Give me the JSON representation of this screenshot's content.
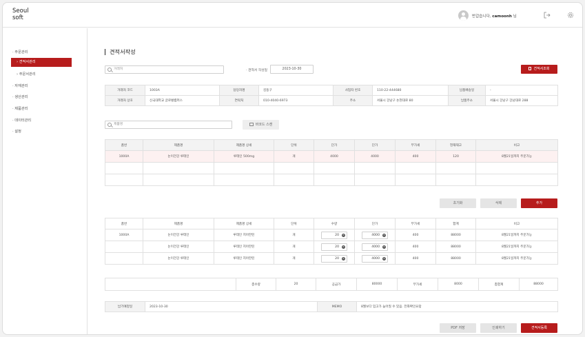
{
  "app": {
    "logo_line1": "Seoul",
    "logo_line2": "soft"
  },
  "header": {
    "greeting": "반갑습니다,",
    "username": "camoonh",
    "suffix": "님",
    "icons": [
      "user-avatar",
      "logout-icon",
      "gear-icon"
    ]
  },
  "sidebar": {
    "items": [
      {
        "label": "· 주문관리"
      },
      {
        "label": "› 견적서관리",
        "active": true
      },
      {
        "label": "› 주문서관리"
      },
      {
        "label": "· 자재관리"
      },
      {
        "label": "· 생산관리"
      },
      {
        "label": "· 제품관리"
      },
      {
        "label": "· 데이터관리"
      },
      {
        "label": "· 설정"
      }
    ]
  },
  "page": {
    "title": "견적서작성"
  },
  "top_filter": {
    "client_placeholder": "거래처",
    "date_label": "· 견적서 작성일",
    "date_value": "2023-10-30",
    "lookup_button": "견적서조회"
  },
  "client_info": {
    "rows": [
      [
        "거래처 코드",
        "1003A",
        "담당자명",
        "김동구",
        "사업자 번호",
        "110-22-444680",
        "납품배송일",
        "-"
      ],
      [
        "거래처 상호",
        "신극대학교 글로벌캠퍼스",
        "연락처",
        "010-4040-6973",
        "주소",
        "서울시 강남구 논현대로 80",
        "납품주소",
        "서울시 강남구 강남대로 288"
      ]
    ]
  },
  "product_search": {
    "placeholder": "제품명",
    "barcode_button": "바코드 스캔"
  },
  "product_table": {
    "headers": [
      "품번",
      "제품명",
      "제품명 상세",
      "단위",
      "단가",
      "단가",
      "부가세",
      "현재재고",
      "비고"
    ],
    "rows": [
      [
        "1000A",
        "눈이건강 루테인",
        "루테인 500mg",
        "개",
        "4000",
        "4000",
        "400",
        "120",
        "8월21일까지 주문가능"
      ],
      [
        "",
        "",
        "",
        "",
        "",
        "",
        "",
        "",
        ""
      ],
      [
        "",
        "",
        "",
        "",
        "",
        "",
        "",
        "",
        ""
      ]
    ]
  },
  "action_buttons": {
    "reset": "초기화",
    "delete": "삭제",
    "add": "추가"
  },
  "order_table": {
    "headers": [
      "품번",
      "제품명",
      "제품명 상세",
      "단위",
      "수량",
      "단가",
      "부가세",
      "합계",
      "비고"
    ],
    "rows": [
      [
        "1000A",
        "눈이건강 루테인",
        "루테인 지아잔틴",
        "개",
        "20",
        "4000",
        "400",
        "88000",
        "8월21일까지 주문가능"
      ],
      [
        "",
        "눈이건강 루테인",
        "루테인 지아잔틴",
        "개",
        "20",
        "4000",
        "400",
        "88000",
        "8월21일까지 주문가능"
      ],
      [
        "",
        "눈이건강 루테인",
        "루테인 지아잔틴",
        "개",
        "20",
        "4000",
        "400",
        "88000",
        "8월21일까지 주문가능"
      ]
    ]
  },
  "totals": {
    "total_qty_label": "총수량",
    "total_qty": "20",
    "supply_label": "공급가",
    "supply": "80000",
    "vat_label": "부가세",
    "vat": "8000",
    "grand_label": "총합계",
    "grand": "88000"
  },
  "delivery": {
    "label": "납기예정일",
    "value": "2023-10-30",
    "memo_label": "MEMO",
    "memo_value": "8월보다 입고가 늦어질 수 있음. 전화확인요망"
  },
  "footer_buttons": {
    "pdf": "PDF 저장",
    "print": "인쇄하기",
    "register": "견적서등록"
  },
  "colors": {
    "accent": "#b71c1c",
    "header_bg": "#f3f3f3",
    "selected_row": "#fdf1f1"
  }
}
